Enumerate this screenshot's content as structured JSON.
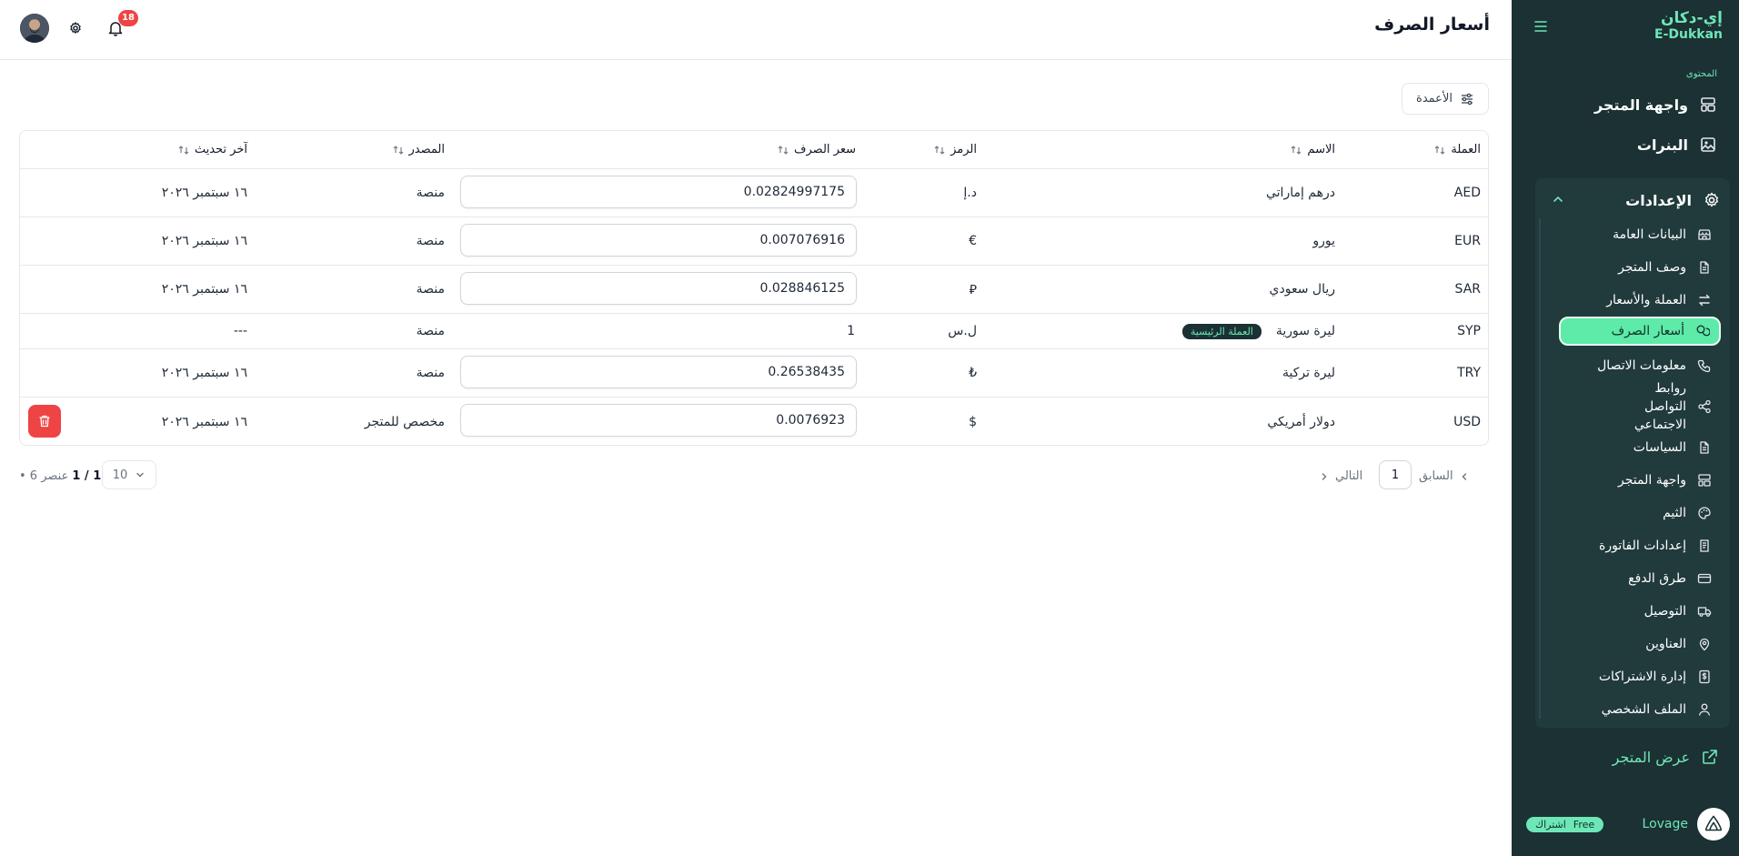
{
  "brand": {
    "name_ar": "إي-دكان",
    "name_en": "E-Dukkan"
  },
  "header": {
    "title": "أسعار الصرف",
    "notification_count": "18"
  },
  "sidebar": {
    "section_label": "المحتوى",
    "top_items": [
      {
        "label": "واجهة المتجر",
        "icon": "layout-icon"
      },
      {
        "label": "البنرات",
        "icon": "image-icon"
      }
    ],
    "settings": {
      "label": "الإعدادات",
      "items": [
        {
          "label": "البيانات العامة",
          "icon": "store-icon"
        },
        {
          "label": "وصف المتجر",
          "icon": "document-icon"
        },
        {
          "label": "العملة والأسعار",
          "icon": "arrows-exchange-icon"
        },
        {
          "label": "أسعار الصرف",
          "icon": "coins-icon",
          "active": true
        },
        {
          "label": "معلومات الاتصال",
          "icon": "phone-icon"
        },
        {
          "label": "روابط التواصل الاجتماعي",
          "icon": "share-icon"
        },
        {
          "label": "السياسات",
          "icon": "document-icon"
        },
        {
          "label": "واجهة المتجر",
          "icon": "layout-icon"
        },
        {
          "label": "الثيم",
          "icon": "palette-icon"
        },
        {
          "label": "إعدادات الفاتورة",
          "icon": "receipt-icon"
        },
        {
          "label": "طرق الدفع",
          "icon": "credit-card-icon"
        },
        {
          "label": "التوصيل",
          "icon": "truck-icon"
        },
        {
          "label": "العناوين",
          "icon": "map-pin-icon"
        },
        {
          "label": "إدارة الاشتراكات",
          "icon": "dollar-icon"
        },
        {
          "label": "الملف الشخصي",
          "icon": "user-icon"
        }
      ]
    },
    "view_store": "عرض المتجر",
    "user": {
      "name": "Lovage",
      "plan_label": "اشتراك",
      "plan": "Free"
    }
  },
  "toolbar": {
    "columns_label": "الأعمدة"
  },
  "table": {
    "headers": {
      "currency": "العملة",
      "name": "الاسم",
      "symbol": "الرمز",
      "rate": "سعر الصرف",
      "source": "المصدر",
      "updated": "آخر تحديث"
    },
    "main_badge": "العملة الرئيسية",
    "rows": [
      {
        "code": "AED",
        "name": "درهم إماراتي",
        "symbol": "د.إ",
        "rate": "0.02824997175",
        "source": "منصة",
        "updated": "١٦ سبتمبر ٢٠٢٦"
      },
      {
        "code": "EUR",
        "name": "يورو",
        "symbol": "€",
        "rate": "0.007076916",
        "source": "منصة",
        "updated": "١٦ سبتمبر ٢٠٢٦"
      },
      {
        "code": "SAR",
        "name": "ريال سعودي",
        "symbol": "⃁",
        "rate": "0.028846125",
        "source": "منصة",
        "updated": "١٦ سبتمبر ٢٠٢٦"
      },
      {
        "code": "SYP",
        "name": "ليرة سورية",
        "symbol": "ل.س",
        "rate": "1",
        "source": "منصة",
        "updated": "---",
        "is_main": true
      },
      {
        "code": "TRY",
        "name": "ليرة تركية",
        "symbol": "₺",
        "rate": "0.26538435",
        "source": "منصة",
        "updated": "١٦ سبتمبر ٢٠٢٦"
      },
      {
        "code": "USD",
        "name": "دولار أمريكي",
        "symbol": "$",
        "rate": "0.0076923",
        "source": "مخصص للمتجر",
        "updated": "١٦ سبتمبر ٢٠٢٦",
        "deletable": true
      }
    ]
  },
  "pagination": {
    "prev": "السابق",
    "next": "التالي",
    "current_page": "1",
    "page_size": "10",
    "page_info": "1 / 1",
    "total": "• 6 عنصر"
  },
  "colors": {
    "sidebar_bg": "#1b3133",
    "accent": "#6ee7b7",
    "danger": "#ef4444"
  }
}
